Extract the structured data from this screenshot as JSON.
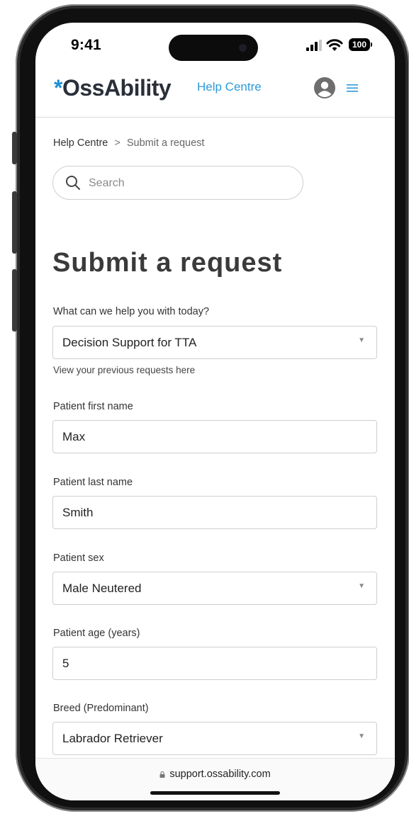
{
  "status_bar": {
    "time": "9:41",
    "battery": "100"
  },
  "header": {
    "logo_star": "*",
    "logo_text": "OssAbility",
    "help_link": "Help Centre"
  },
  "breadcrumb": {
    "home": "Help Centre",
    "separator": ">",
    "current": "Submit a request"
  },
  "search": {
    "placeholder": "Search"
  },
  "page_title": "Submit a request",
  "form": {
    "request_type": {
      "label": "What can we help you with today?",
      "value": "Decision Support for TTA"
    },
    "previous_link": "View your previous requests here",
    "first_name": {
      "label": "Patient first name",
      "value": "Max"
    },
    "last_name": {
      "label": "Patient last name",
      "value": "Smith"
    },
    "sex": {
      "label": "Patient sex",
      "value": "Male Neutered"
    },
    "age": {
      "label": "Patient age (years)",
      "value": "5"
    },
    "breed": {
      "label": "Breed (Predominant)",
      "value": "Labrador Retriever"
    }
  },
  "browser": {
    "url": "support.ossability.com"
  },
  "icons": {
    "search": "search-icon",
    "avatar": "user-avatar-icon",
    "menu": "hamburger-menu-icon",
    "lock": "lock-icon",
    "caret": "caret-down-icon"
  },
  "colors": {
    "brand_blue": "#1e8fd6",
    "link_blue": "#2c9ad8",
    "title_gray": "#3a3a3a"
  }
}
